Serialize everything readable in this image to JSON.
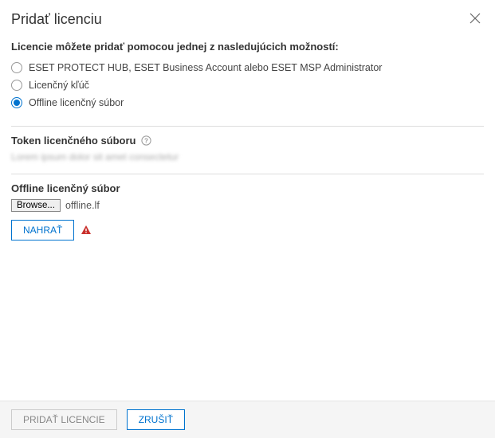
{
  "header": {
    "title": "Pridať licenciu"
  },
  "intro": {
    "label": "Licencie môžete pridať pomocou jednej z nasledujúcich možností:"
  },
  "options": {
    "hub": "ESET PROTECT HUB, ESET Business Account alebo ESET MSP Administrator",
    "key": "Licenčný kľúč",
    "offline": "Offline licenčný súbor"
  },
  "token": {
    "title": "Token licenčného súboru",
    "blurred": "Lorem ipsum dolor sit amet consectetur"
  },
  "offlineFile": {
    "title": "Offline licenčný súbor",
    "browse": "Browse...",
    "filename": "offline.lf",
    "upload": "NAHRAŤ"
  },
  "footer": {
    "add": "PRIDAŤ LICENCIE",
    "cancel": "ZRUŠIŤ"
  }
}
